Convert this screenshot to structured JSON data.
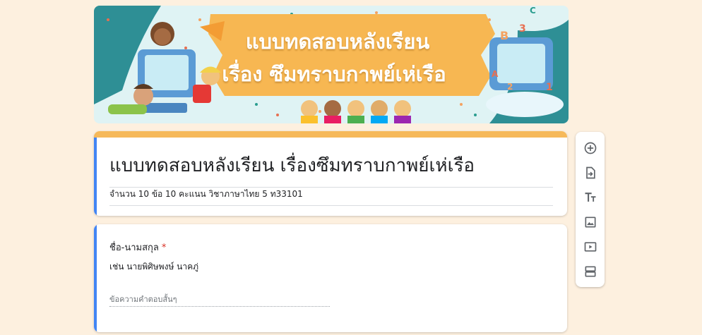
{
  "banner": {
    "line1": "แบบทดสอบหลังเรียน",
    "line2": "เรื่อง ซึมทราบกาพย์เห่เรือ",
    "letters": [
      "B",
      "3",
      "C",
      "1",
      "2",
      "A"
    ]
  },
  "form": {
    "title": "แบบทดสอบหลังเรียน เรื่องซึมทราบกาพย์เห่เรือ",
    "description": "จำนวน 10 ข้อ 10 คะแนน วิชาภาษาไทย 5 ท33101"
  },
  "question": {
    "title": "ชื่อ-นามสกุล",
    "required_mark": "*",
    "help_text": "เช่น นายพิศิษพงษ์ นาคภู่",
    "placeholder": "ข้อความคำตอบสั้นๆ"
  },
  "toolbar": {
    "items": [
      "add-question-icon",
      "import-questions-icon",
      "add-title-icon",
      "add-image-icon",
      "add-video-icon",
      "add-section-icon"
    ]
  },
  "colors": {
    "page_bg": "#fdf0df",
    "theme_accent": "#f6b95a",
    "focus_bar": "#4285f4",
    "required": "#d93025"
  }
}
